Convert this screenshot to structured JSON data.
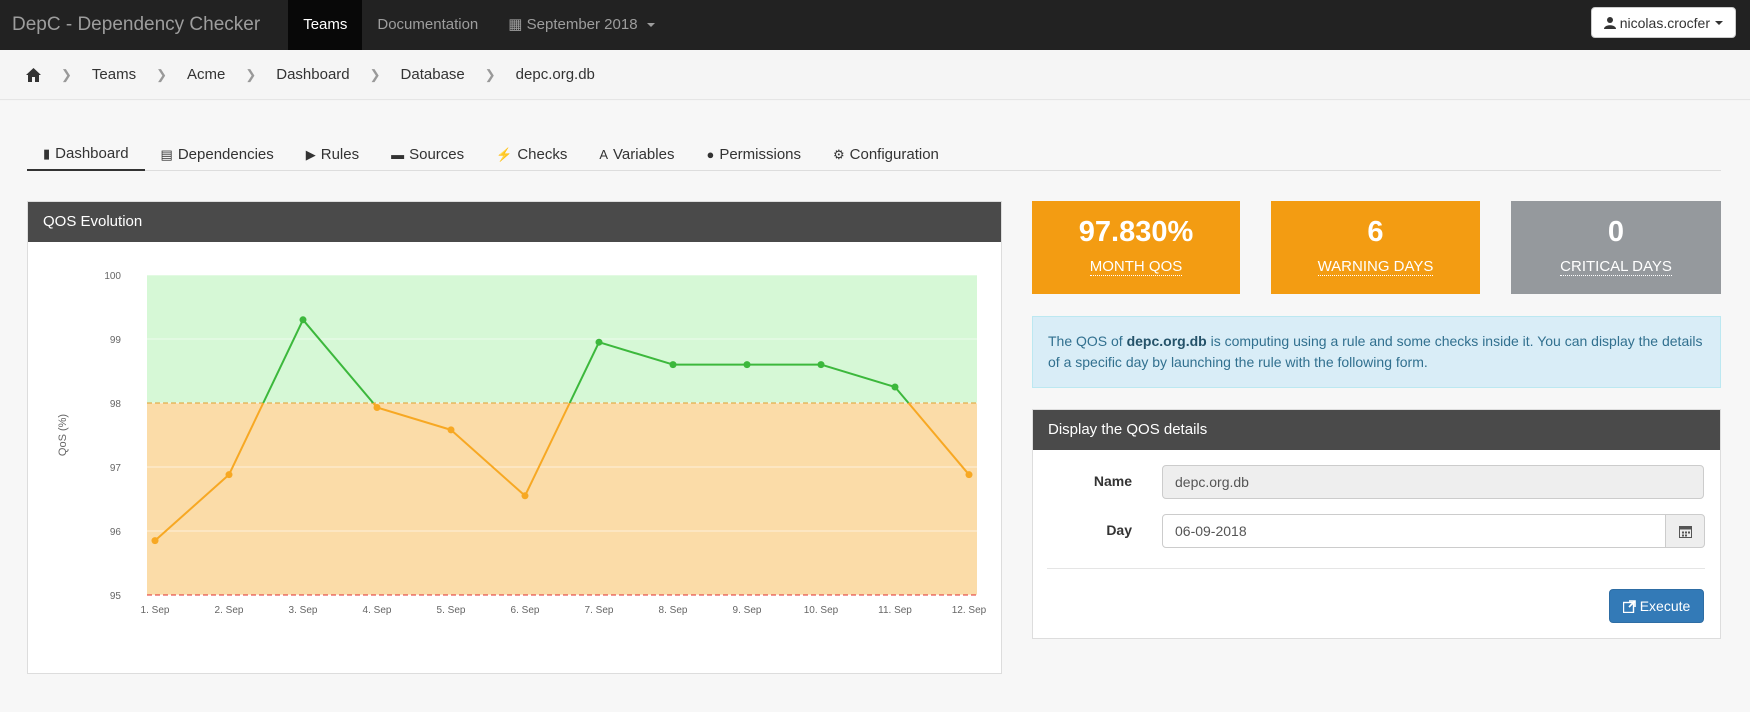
{
  "navbar": {
    "brand": "DepC - Dependency Checker",
    "items": [
      {
        "label": "Teams"
      },
      {
        "label": "Documentation"
      },
      {
        "label": "September 2018"
      }
    ],
    "user": "nicolas.crocfer"
  },
  "breadcrumb": [
    "Teams",
    "Acme",
    "Dashboard",
    "Database",
    "depc.org.db"
  ],
  "tabs": [
    "Dashboard",
    "Dependencies",
    "Rules",
    "Sources",
    "Checks",
    "Variables",
    "Permissions",
    "Configuration"
  ],
  "qos_panel": {
    "title": "QOS Evolution"
  },
  "stats": {
    "month_qos": {
      "value": "97.830%",
      "label": "MONTH QOS"
    },
    "warning_days": {
      "value": "6",
      "label": "WARNING DAYS"
    },
    "critical_days": {
      "value": "0",
      "label": "CRITICAL DAYS"
    }
  },
  "info": {
    "prefix": "The QOS of ",
    "name": "depc.org.db",
    "suffix": " is computing using a rule and some checks inside it. You can display the details of a specific day by launching the rule with the following form."
  },
  "details_form": {
    "title": "Display the QOS details",
    "name_label": "Name",
    "name_value": "depc.org.db",
    "day_label": "Day",
    "day_value": "06-09-2018",
    "execute_label": "Execute"
  },
  "colors": {
    "good_zone": "#d6f8d6",
    "warning_zone": "#fbdca8",
    "good_line": "#3cb83c",
    "warning_line": "#f7a823",
    "critical_line": "#e03030",
    "threshold": "#e0a030"
  },
  "chart_data": {
    "type": "line",
    "title": "",
    "xlabel": "",
    "ylabel": "QoS (%)",
    "categories": [
      "1. Sep",
      "2. Sep",
      "3. Sep",
      "4. Sep",
      "5. Sep",
      "6. Sep",
      "7. Sep",
      "8. Sep",
      "9. Sep",
      "10. Sep",
      "11. Sep",
      "12. Sep"
    ],
    "values": [
      95.85,
      96.88,
      99.3,
      97.93,
      97.58,
      96.55,
      98.95,
      98.6,
      98.6,
      98.6,
      98.25,
      96.88
    ],
    "ylim": [
      95,
      100
    ],
    "yticks": [
      95,
      96,
      97,
      98,
      99,
      100
    ],
    "zones": [
      {
        "from": 98,
        "to": 100,
        "label": "good"
      },
      {
        "from": 95,
        "to": 98,
        "label": "warning"
      }
    ],
    "warning_threshold": 98,
    "critical_threshold": 95,
    "grid": true,
    "legend": "none"
  }
}
